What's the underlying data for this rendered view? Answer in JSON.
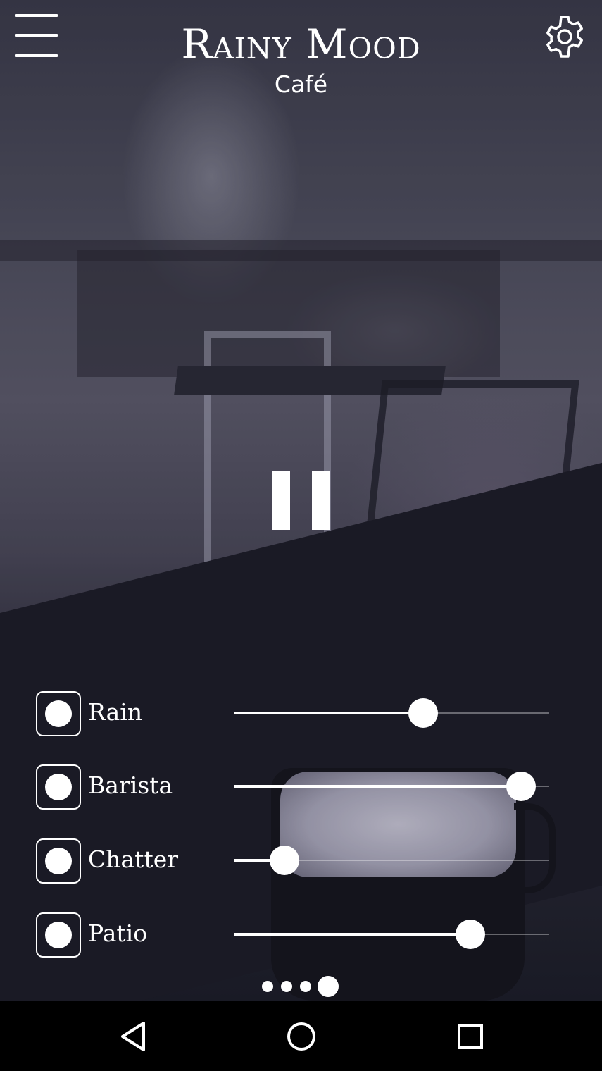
{
  "app": {
    "title": "Rainy Mood",
    "subtitle": "Café"
  },
  "icons": {
    "menu": "hamburger-menu-icon",
    "settings": "gear-icon",
    "playback": "pause-icon",
    "nav_back": "triangle-back-icon",
    "nav_home": "circle-home-icon",
    "nav_recents": "square-recents-icon"
  },
  "playback": {
    "state": "playing"
  },
  "sounds": [
    {
      "label": "Rain",
      "enabled": true,
      "level": 0.6
    },
    {
      "label": "Barista",
      "enabled": true,
      "level": 0.91
    },
    {
      "label": "Chatter",
      "enabled": true,
      "level": 0.16
    },
    {
      "label": "Patio",
      "enabled": true,
      "level": 0.75
    }
  ],
  "pager": {
    "count": 4,
    "active_index": 3
  },
  "colors": {
    "foreground": "#ffffff",
    "navbar": "#000000"
  }
}
